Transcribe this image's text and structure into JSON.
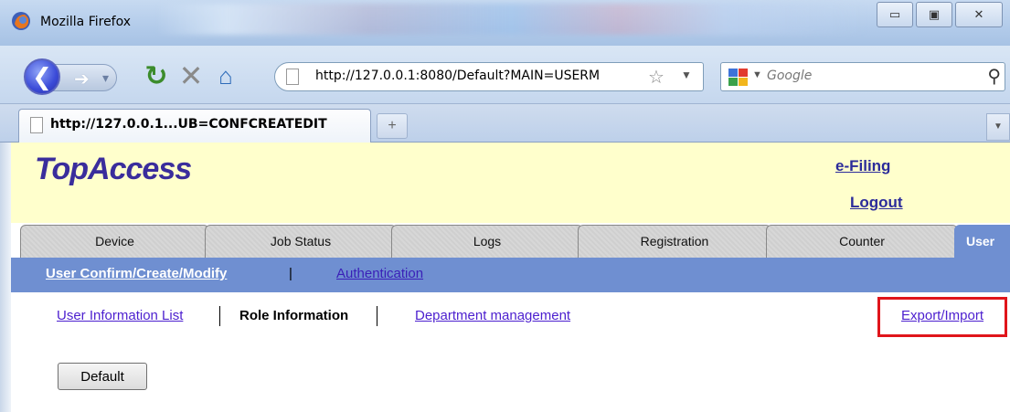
{
  "window": {
    "title": "Mozilla Firefox",
    "buttons": {
      "minimize": "▭",
      "maximize": "▣",
      "close": "✕"
    }
  },
  "navbar": {
    "url": "http://127.0.0.1:8080/Default?MAIN=USERM",
    "search_placeholder": "Google"
  },
  "browser_tabs": [
    {
      "title": "http://127.0.0.1...UB=CONFCREATEDIT"
    }
  ],
  "page": {
    "logo": "TopAccess",
    "header_links": {
      "efiling": "e-Filing",
      "logout": "Logout"
    },
    "main_tabs": [
      {
        "label": "Device"
      },
      {
        "label": "Job Status"
      },
      {
        "label": "Logs"
      },
      {
        "label": "Registration"
      },
      {
        "label": "Counter"
      },
      {
        "label": "User"
      }
    ],
    "subnav": {
      "user_confirm": "User Confirm/Create/Modify",
      "separator": "|",
      "authentication": "Authentication"
    },
    "third_level": {
      "user_info_list": "User Information List",
      "role_info": "Role Information",
      "dept_mgmt": "Department management",
      "export_import": "Export/Import"
    },
    "default_button": "Default"
  },
  "colors": {
    "header_band": "#ffffcc",
    "tab_active": "#6f8fd1",
    "link_purple": "#4c1fcf",
    "highlight": "#e0151b"
  }
}
